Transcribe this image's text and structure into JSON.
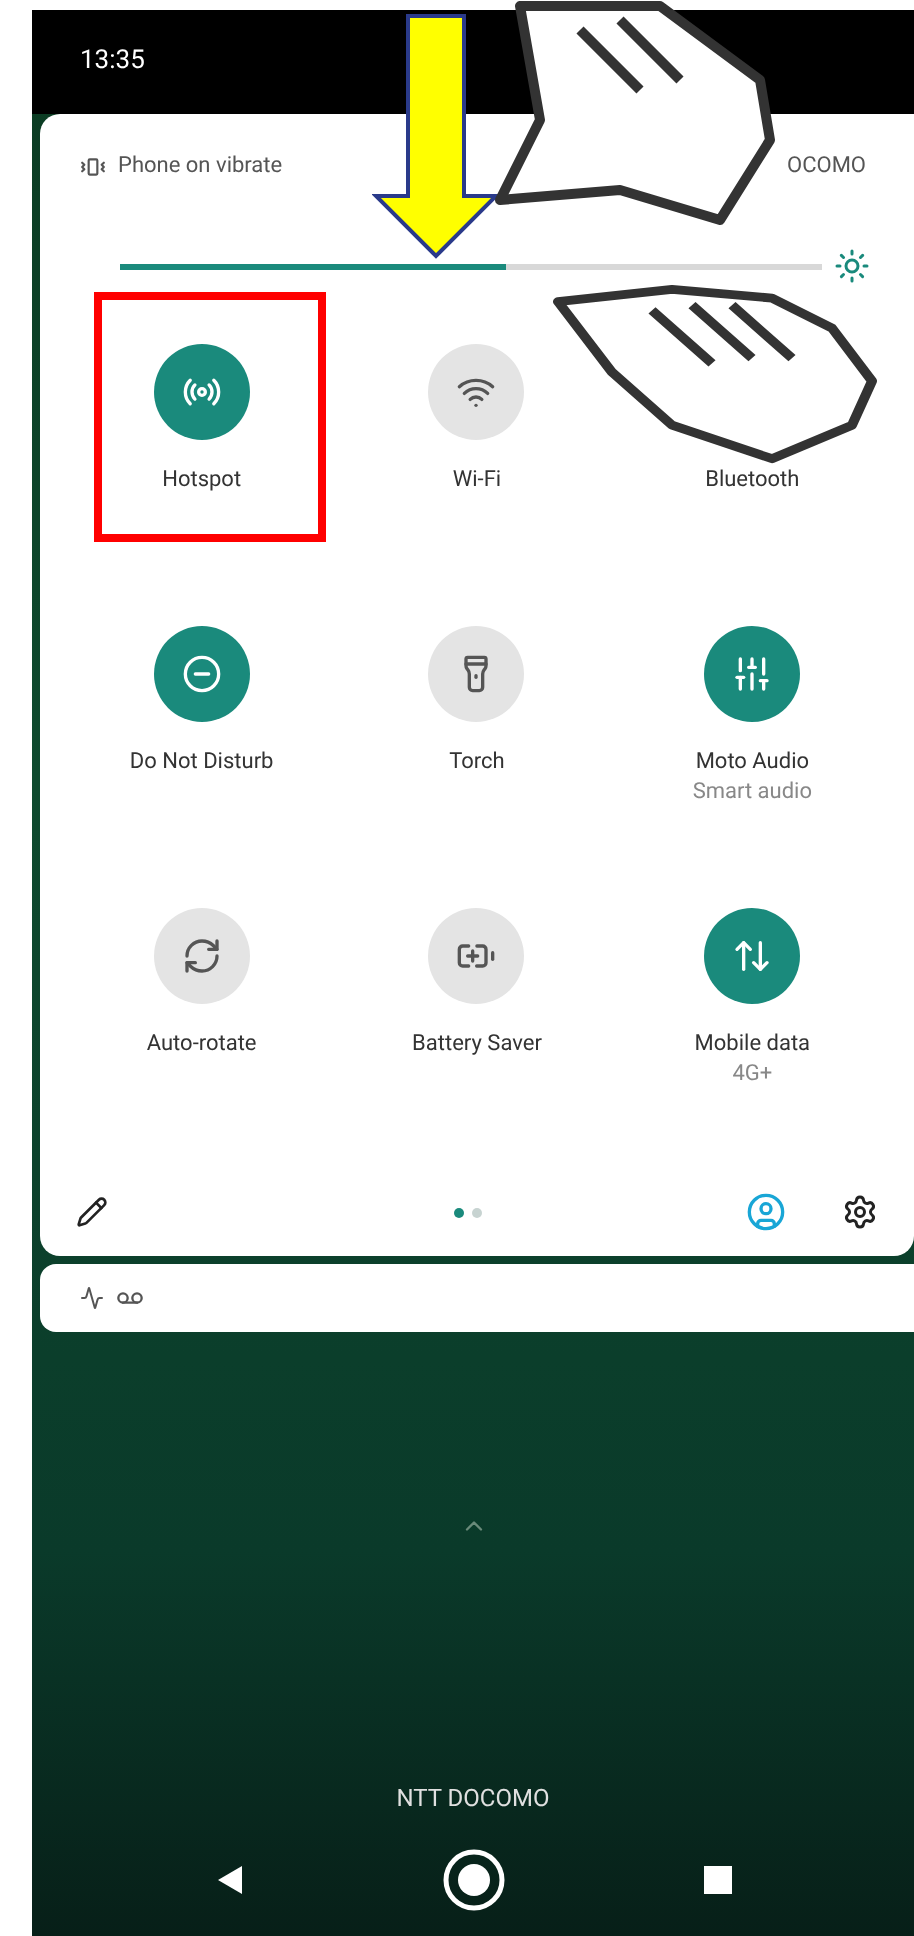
{
  "status_bar": {
    "time": "13:35"
  },
  "quick_settings": {
    "ringer_status": "Phone on vibrate",
    "carrier": "OCOMO",
    "brightness": {
      "level": 0.55
    },
    "tiles": [
      {
        "kind": "hotspot",
        "label": "Hotspot",
        "on": true
      },
      {
        "kind": "wifi",
        "label": "Wi-Fi",
        "on": false
      },
      {
        "kind": "bluetooth",
        "label": "Bluetooth"
      },
      {
        "kind": "dnd",
        "label": "Do Not Disturb",
        "on": true
      },
      {
        "kind": "torch",
        "label": "Torch",
        "on": false
      },
      {
        "kind": "audio",
        "label": "Moto Audio",
        "sublabel": "Smart audio",
        "on": true
      },
      {
        "kind": "rotate",
        "label": "Auto-rotate",
        "on": false
      },
      {
        "kind": "battery",
        "label": "Battery Saver",
        "on": false
      },
      {
        "kind": "data",
        "label": "Mobile data",
        "sublabel": "4G+",
        "on": true
      }
    ],
    "pages": [
      {
        "selected": true
      },
      {
        "selected": false
      }
    ]
  },
  "lock_screen": {
    "carrier": "NTT DOCOMO"
  }
}
